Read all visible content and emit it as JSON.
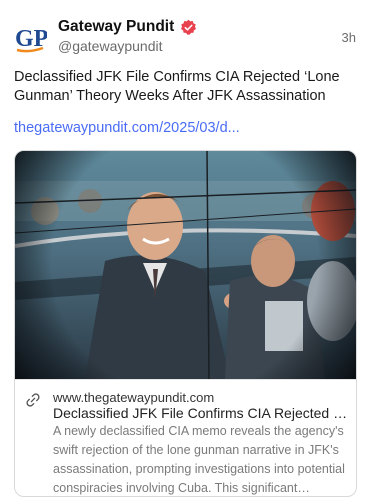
{
  "author": {
    "avatar_text": "GP",
    "display_name": "Gateway Pundit",
    "handle": "@gatewaypundit",
    "verified": true
  },
  "timestamp": "3h",
  "post": {
    "text": "Declassified JFK File Confirms CIA Rejected ‘Lone Gunman’ Theory Weeks After JFK Assassination",
    "link_text": "thegatewaypundit.com/2025/03/d..."
  },
  "link_card": {
    "domain": "www.thegatewaypundit.com",
    "title": "Declassified JFK File Confirms CIA Rejected 'Lone Gunman' Theory Weeks After JFK Assassination",
    "description": "A newly declassified CIA memo reveals the agency's swift rejection of the lone gunman narrative in JFK's assassination, prompting investigations into potential conspiracies involving Cuba. This significant document sheds light on the agency's early doubts."
  },
  "colors": {
    "link": "#4a6cf5",
    "verified_badge": "#e8424e",
    "avatar_blue": "#1f4a92",
    "avatar_orange": "#f08a1c"
  },
  "icons": [
    "gp-logo",
    "verified-badge-icon",
    "link-icon"
  ]
}
